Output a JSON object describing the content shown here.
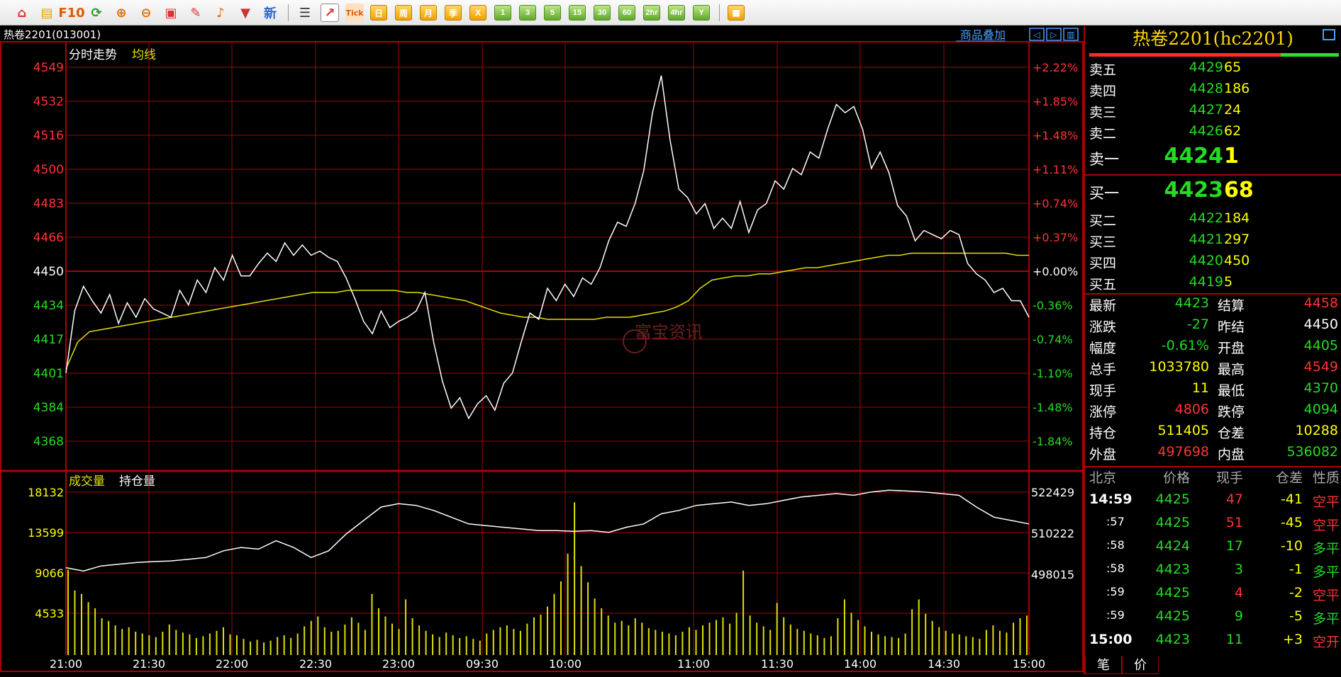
{
  "toolbar": {
    "buttons": [
      {
        "name": "home-icon",
        "glyph": "⌂",
        "color": "#d33"
      },
      {
        "name": "stack-icon",
        "glyph": "▤",
        "color": "#e8a000"
      },
      {
        "name": "f10-icon",
        "glyph": "F10",
        "color": "#e05a00"
      },
      {
        "name": "refresh-icon",
        "glyph": "⟳",
        "color": "#2a9a2a"
      },
      {
        "name": "zoom-in-icon",
        "glyph": "⊕",
        "color": "#e06a00"
      },
      {
        "name": "zoom-out-icon",
        "glyph": "⊖",
        "color": "#e06a00"
      },
      {
        "name": "window-icon",
        "glyph": "▣",
        "color": "#d33"
      },
      {
        "name": "pen-icon",
        "glyph": "✎",
        "color": "#d33"
      },
      {
        "name": "bell-icon",
        "glyph": "♪",
        "color": "#e06a00"
      },
      {
        "name": "filter-icon",
        "glyph": "▼",
        "color": "#c33"
      },
      {
        "name": "new-icon",
        "glyph": "新",
        "color": "#2a6ad0"
      }
    ],
    "view_buttons": [
      {
        "name": "table-view-button",
        "glyph": "☰",
        "color": "#333"
      },
      {
        "name": "intraday-chart-button",
        "glyph": "↗",
        "color": "#d33",
        "selected": true
      },
      {
        "name": "tick-button",
        "glyph": "Tick",
        "color": "#e05a00"
      }
    ],
    "period_buttons": [
      "日",
      "周",
      "月",
      "季",
      "X"
    ],
    "minute_buttons": [
      "1",
      "3",
      "5",
      "15",
      "30",
      "60",
      "2hr",
      "4hr",
      "Y"
    ],
    "calc_icon": "calculator-icon"
  },
  "chart": {
    "contract_label": "热卷2201(013001)",
    "overlay_link": "商品叠加",
    "legend_price": "分时走势",
    "legend_avg": "均线",
    "legend_volume": "成交量",
    "legend_oi": "持仓量",
    "watermark": "富宝资讯",
    "price_ticks": [
      "4549",
      "4532",
      "4516",
      "4500",
      "4483",
      "4466",
      "4450",
      "4434",
      "4417",
      "4401",
      "4384",
      "4368"
    ],
    "pct_ticks": [
      "+2.22%",
      "+1.85%",
      "+1.48%",
      "+1.11%",
      "+0.74%",
      "+0.37%",
      "+0.00%",
      "-0.36%",
      "-0.74%",
      "-1.10%",
      "-1.48%",
      "-1.84%"
    ],
    "volume_ticks": [
      "18132",
      "13599",
      "9066",
      "4533"
    ],
    "oi_ticks": [
      "522429",
      "510222",
      "498015"
    ],
    "time_ticks": [
      "21:00",
      "21:30",
      "22:00",
      "22:30",
      "23:00",
      "09:30",
      "10:00",
      "11:00",
      "11:30",
      "14:00",
      "14:30",
      "15:00"
    ]
  },
  "chart_data": {
    "type": "line",
    "title": "",
    "xlabel": "",
    "ylabel": "",
    "prev_settle": 4450,
    "ylim": [
      4360,
      4552
    ],
    "series": [
      {
        "name": "分时走势",
        "color": "#ffffff",
        "values": [
          4401,
          4431,
          4443,
          4436,
          4430,
          4439,
          4425,
          4435,
          4428,
          4437,
          4432,
          4430,
          4428,
          4441,
          4434,
          4446,
          4440,
          4452,
          4446,
          4458,
          4448,
          4448,
          4454,
          4459,
          4455,
          4464,
          4458,
          4463,
          4458,
          4460,
          4457,
          4455,
          4447,
          4437,
          4426,
          4420,
          4431,
          4423,
          4426,
          4428,
          4431,
          4440,
          4416,
          4397,
          4384,
          4389,
          4379,
          4386,
          4390,
          4383,
          4396,
          4401,
          4416,
          4430,
          4427,
          4442,
          4436,
          4444,
          4438,
          4447,
          4444,
          4452,
          4465,
          4474,
          4472,
          4483,
          4499,
          4527,
          4545,
          4514,
          4490,
          4486,
          4478,
          4483,
          4471,
          4476,
          4471,
          4484,
          4469,
          4480,
          4483,
          4494,
          4490,
          4500,
          4497,
          4508,
          4505,
          4519,
          4531,
          4527,
          4530,
          4519,
          4500,
          4508,
          4498,
          4482,
          4477,
          4465,
          4470,
          4468,
          4466,
          4470,
          4468,
          4454,
          4449,
          4446,
          4440,
          4442,
          4436,
          4436,
          4428
        ]
      },
      {
        "name": "均线",
        "color": "#e0e000",
        "values": [
          4403,
          4416,
          4421,
          4422,
          4423,
          4424,
          4425,
          4426,
          4427,
          4428,
          4429,
          4430,
          4431,
          4432,
          4433,
          4434,
          4435,
          4436,
          4437,
          4438,
          4439,
          4440,
          4440,
          4440,
          4441,
          4441,
          4441,
          4441,
          4441,
          4440,
          4440,
          4439,
          4438,
          4437,
          4436,
          4434,
          4432,
          4430,
          4429,
          4428,
          4428,
          4427,
          4427,
          4427,
          4427,
          4427,
          4428,
          4428,
          4428,
          4429,
          4430,
          4431,
          4433,
          4436,
          4442,
          4446,
          4447,
          4448,
          4448,
          4449,
          4449,
          4450,
          4451,
          4452,
          4452,
          4453,
          4454,
          4455,
          4456,
          4457,
          4458,
          4458,
          4459,
          4459,
          4459,
          4459,
          4459,
          4459,
          4459,
          4459,
          4459,
          4458,
          4458
        ]
      },
      {
        "name": "持仓量",
        "color": "#ffffff",
        "values": [
          500000,
          499000,
          500500,
          501000,
          501500,
          501800,
          502000,
          502500,
          503000,
          505000,
          506000,
          505500,
          508000,
          506000,
          503000,
          505000,
          510000,
          514000,
          518000,
          519000,
          518500,
          517000,
          515000,
          513000,
          512500,
          512000,
          511500,
          511000,
          511000,
          510800,
          511000,
          510500,
          512000,
          513000,
          516000,
          517000,
          518500,
          519000,
          519500,
          518500,
          519000,
          520000,
          521000,
          521500,
          522000,
          521500,
          522500,
          523000,
          522800,
          522500,
          522000,
          521500,
          518000,
          515000,
          514000,
          513000
        ]
      },
      {
        "name": "成交量",
        "color": "#e0e000",
        "values": [
          9500,
          7200,
          6800,
          5900,
          5200,
          4100,
          3800,
          3300,
          2900,
          3100,
          2600,
          2400,
          2200,
          2000,
          2600,
          3400,
          2800,
          2500,
          2300,
          1900,
          2100,
          2400,
          2700,
          3100,
          2300,
          2200,
          1800,
          1500,
          1700,
          1400,
          1600,
          2000,
          2200,
          1900,
          2400,
          3200,
          3800,
          4300,
          3100,
          2600,
          2700,
          3400,
          4200,
          3600,
          2800,
          6800,
          5200,
          4300,
          3500,
          2900,
          6200,
          4100,
          3300,
          2700,
          2300,
          2000,
          2500,
          2200,
          1900,
          2100,
          1800,
          1600,
          2400,
          2800,
          3100,
          3300,
          2900,
          2700,
          3500,
          4200,
          4500,
          5400,
          6800,
          8200,
          11300,
          17000,
          9900,
          8100,
          6300,
          5200,
          4400,
          3600,
          3800,
          3300,
          4100,
          3600,
          3000,
          2800,
          2600,
          2400,
          2200,
          2600,
          3100,
          2800,
          3300,
          3600,
          3900,
          4200,
          3500,
          4700,
          9400,
          4400,
          3600,
          3200,
          2800,
          5800,
          4200,
          3400,
          2900,
          2700,
          2400,
          2200,
          1900,
          2100,
          4100,
          6200,
          4700,
          3900,
          3200,
          2600,
          2300,
          2100,
          2000,
          1900,
          2400,
          5100,
          6200,
          4600,
          3800,
          3100,
          2700,
          2400,
          2300,
          2100,
          2000,
          1800,
          2800,
          3300,
          2700,
          2500,
          3600,
          4100,
          4400
        ]
      }
    ]
  },
  "quote": {
    "title": "热卷2201(hc2201)",
    "sells": [
      {
        "label": "卖五",
        "price": "4429",
        "vol": "65"
      },
      {
        "label": "卖四",
        "price": "4428",
        "vol": "186"
      },
      {
        "label": "卖三",
        "price": "4427",
        "vol": "24"
      },
      {
        "label": "卖二",
        "price": "4426",
        "vol": "62"
      },
      {
        "label": "卖一",
        "price": "4424",
        "vol": "1"
      }
    ],
    "buys": [
      {
        "label": "买一",
        "price": "4423",
        "vol": "68"
      },
      {
        "label": "买二",
        "price": "4422",
        "vol": "184"
      },
      {
        "label": "买三",
        "price": "4421",
        "vol": "297"
      },
      {
        "label": "买四",
        "price": "4420",
        "vol": "450"
      },
      {
        "label": "买五",
        "price": "4419",
        "vol": "5"
      }
    ],
    "stats": [
      {
        "l1": "最新",
        "v1": "4423",
        "c1": "#22dd22",
        "l2": "结算",
        "v2": "4458",
        "c2": "#ff3333"
      },
      {
        "l1": "涨跌",
        "v1": "-27",
        "c1": "#22dd22",
        "l2": "昨结",
        "v2": "4450",
        "c2": "#ffffff"
      },
      {
        "l1": "幅度",
        "v1": "-0.61%",
        "c1": "#22dd22",
        "l2": "开盘",
        "v2": "4405",
        "c2": "#22dd22"
      },
      {
        "l1": "总手",
        "v1": "1033780",
        "c1": "#ffff00",
        "l2": "最高",
        "v2": "4549",
        "c2": "#ff3333"
      },
      {
        "l1": "现手",
        "v1": "11",
        "c1": "#ffff00",
        "l2": "最低",
        "v2": "4370",
        "c2": "#22dd22"
      },
      {
        "l1": "涨停",
        "v1": "4806",
        "c1": "#ff3333",
        "l2": "跌停",
        "v2": "4094",
        "c2": "#22dd22"
      },
      {
        "l1": "持仓",
        "v1": "511405",
        "c1": "#ffff00",
        "l2": "仓差",
        "v2": "10288",
        "c2": "#ffff00"
      },
      {
        "l1": "外盘",
        "v1": "497698",
        "c1": "#ff3333",
        "l2": "内盘",
        "v2": "536082",
        "c2": "#22dd22"
      }
    ],
    "trade_headers": [
      "北京",
      "价格",
      "现手",
      "仓差",
      "性质"
    ],
    "trades": [
      {
        "time": "14:59",
        "price": "4425",
        "vol": "47",
        "vc": "#ff3333",
        "diff": "-41",
        "type": "空平",
        "tc": "#ff3333"
      },
      {
        "time": ":57",
        "price": "4425",
        "vol": "51",
        "vc": "#ff3333",
        "diff": "-45",
        "type": "空平",
        "tc": "#ff3333"
      },
      {
        "time": ":58",
        "price": "4424",
        "vol": "17",
        "vc": "#22dd22",
        "diff": "-10",
        "type": "多平",
        "tc": "#22dd22"
      },
      {
        "time": ":58",
        "price": "4423",
        "vol": "3",
        "vc": "#22dd22",
        "diff": "-1",
        "type": "多平",
        "tc": "#22dd22"
      },
      {
        "time": ":59",
        "price": "4425",
        "vol": "4",
        "vc": "#ff3333",
        "diff": "-2",
        "type": "空平",
        "tc": "#ff3333"
      },
      {
        "time": ":59",
        "price": "4425",
        "vol": "9",
        "vc": "#22dd22",
        "diff": "-5",
        "type": "多平",
        "tc": "#22dd22"
      },
      {
        "time": "15:00",
        "price": "4423",
        "vol": "11",
        "vc": "#22dd22",
        "diff": "+3",
        "type": "空开",
        "tc": "#ff3333"
      }
    ],
    "tabs": [
      "笔",
      "价"
    ]
  }
}
